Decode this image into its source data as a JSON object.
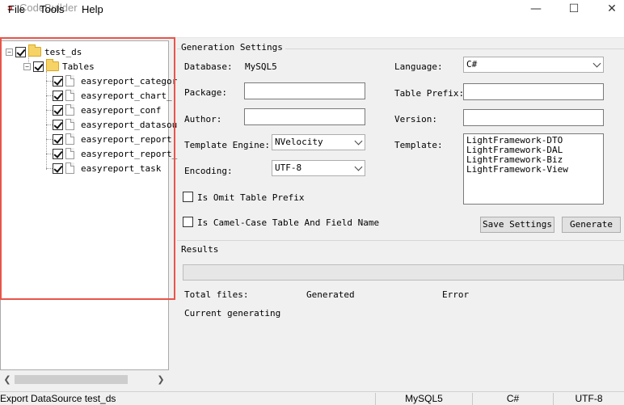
{
  "window": {
    "title": "CodeBuilder",
    "icon": "app-logo-icon",
    "controls": [
      "minimize-icon",
      "maximize-icon",
      "close-icon"
    ]
  },
  "menu": [
    "File",
    "Tools",
    "Help"
  ],
  "tree": {
    "root": "test_ds",
    "group": "Tables",
    "tables": [
      "easyreport_categor",
      "easyreport_chart_",
      "easyreport_conf",
      "easyreport_datasou",
      "easyreport_report",
      "easyreport_report_",
      "easyreport_task"
    ]
  },
  "settings": {
    "legend": "Generation Settings",
    "database_label": "Database:",
    "database_value": "MySQL5",
    "package_label": "Package:",
    "package_value": "",
    "author_label": "Author:",
    "author_value": "",
    "engine_label": "Template Engine:",
    "engine_value": "NVelocity",
    "encoding_label": "Encoding:",
    "encoding_value": "UTF-8",
    "language_label": "Language:",
    "language_value": "C#",
    "prefix_label": "Table Prefix:",
    "prefix_value": "",
    "version_label": "Version:",
    "version_value": "",
    "template_label": "Template:",
    "templates": [
      "LightFramework-DTO",
      "LightFramework-DAL",
      "LightFramework-Biz",
      "LightFramework-View"
    ],
    "omit_prefix_label": "Is Omit Table Prefix",
    "omit_prefix_checked": false,
    "camel_case_label": "Is Camel-Case Table And Field Name",
    "camel_case_checked": false,
    "save_button": "Save Settings",
    "generate_button": "Generate"
  },
  "results": {
    "legend": "Results",
    "progress": 0,
    "total_label": "Total files:",
    "generated_label": "Generated",
    "error_label": "Error",
    "current_label": "Current generating"
  },
  "status": {
    "message": "Export DataSource test_ds",
    "database": "MySQL5",
    "language": "C#",
    "encoding": "UTF-8"
  }
}
